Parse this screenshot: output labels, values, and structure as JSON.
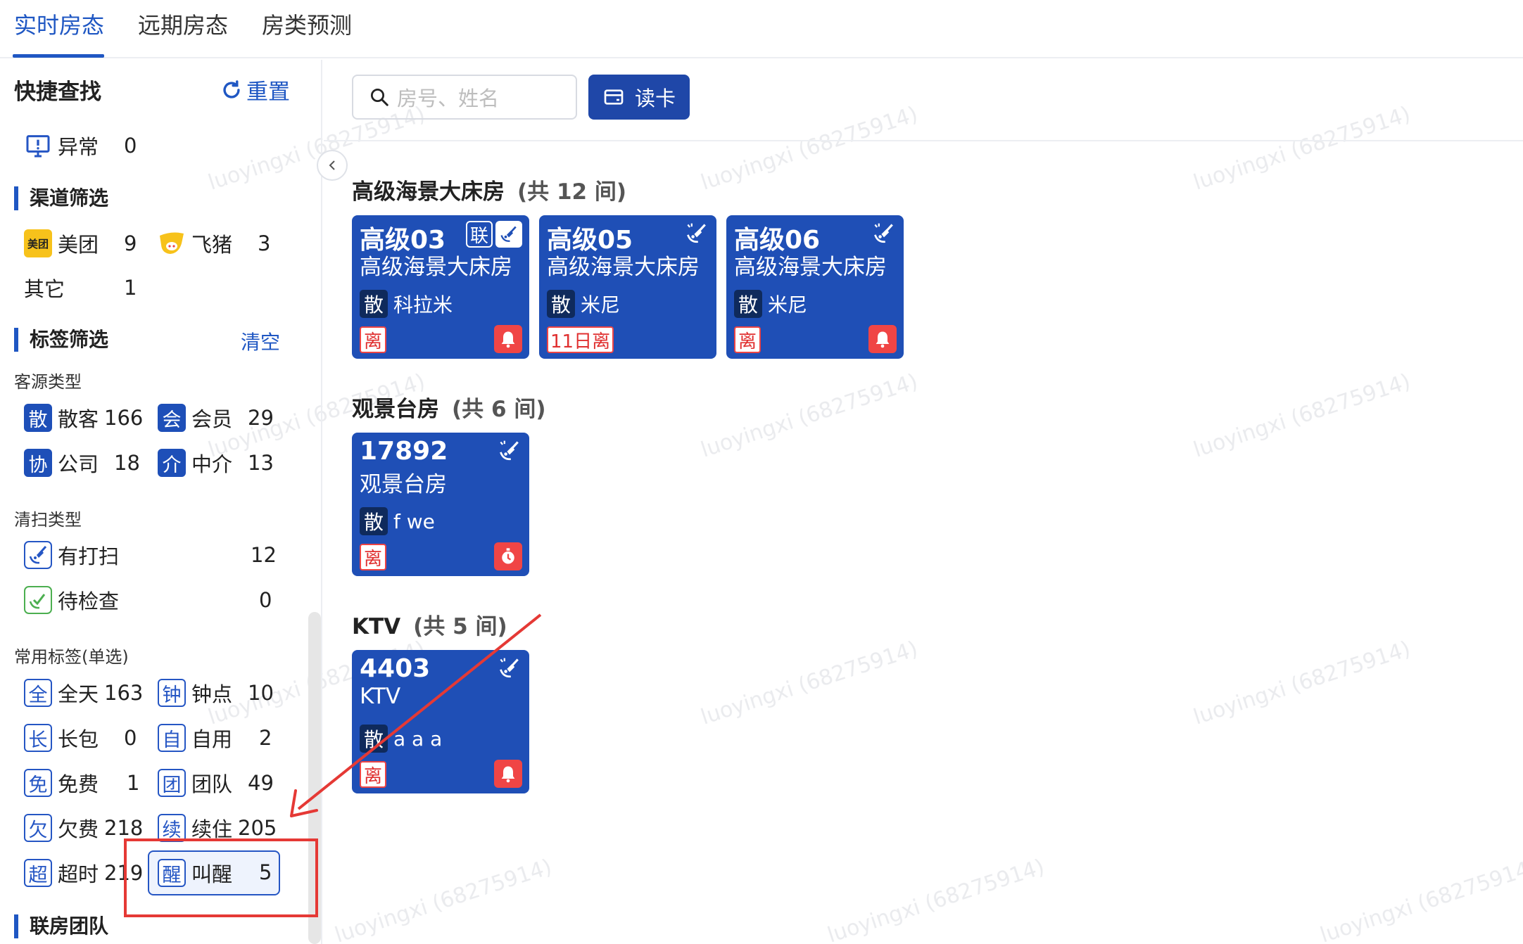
{
  "tabs": [
    {
      "label": "实时房态",
      "active": true
    },
    {
      "label": "远期房态",
      "active": false
    },
    {
      "label": "房类预测",
      "active": false
    }
  ],
  "sidebar": {
    "title": "快捷查找",
    "reset_label": "重置",
    "abnormal": {
      "label": "异常",
      "count": "0"
    },
    "channel_section": "渠道筛选",
    "channels": [
      {
        "label": "美团",
        "count": "9",
        "icon": "meituan-icon",
        "icon_text": "美团"
      },
      {
        "label": "飞猪",
        "count": "3",
        "icon": "fliggy-icon"
      },
      {
        "label": "其它",
        "count": "1"
      }
    ],
    "tag_section": "标签筛选",
    "clear_label": "清空",
    "guest_type_title": "客源类型",
    "guest_types": [
      {
        "badge": "散",
        "label": "散客",
        "count": "166"
      },
      {
        "badge": "会",
        "label": "会员",
        "count": "29"
      },
      {
        "badge": "协",
        "label": "公司",
        "count": "18"
      },
      {
        "badge": "介",
        "label": "中介",
        "count": "13"
      }
    ],
    "clean_type_title": "清扫类型",
    "clean_types": [
      {
        "label": "有打扫",
        "count": "12",
        "icon": "cleaning-icon"
      },
      {
        "label": "待检查",
        "count": "0",
        "icon": "inspection-icon"
      }
    ],
    "common_tags_title": "常用标签(单选)",
    "common_tags": [
      {
        "badge": "全",
        "label": "全天",
        "count": "163"
      },
      {
        "badge": "钟",
        "label": "钟点",
        "count": "10"
      },
      {
        "badge": "长",
        "label": "长包",
        "count": "0"
      },
      {
        "badge": "自",
        "label": "自用",
        "count": "2"
      },
      {
        "badge": "免",
        "label": "免费",
        "count": "1"
      },
      {
        "badge": "团",
        "label": "团队",
        "count": "49"
      },
      {
        "badge": "欠",
        "label": "欠费",
        "count": "218"
      },
      {
        "badge": "续",
        "label": "续住",
        "count": "205"
      },
      {
        "badge": "超",
        "label": "超时",
        "count": "219"
      },
      {
        "badge": "醒",
        "label": "叫醒",
        "count": "5",
        "selected": true
      }
    ],
    "linked_section": "联房团队"
  },
  "search": {
    "placeholder": "房号、姓名"
  },
  "read_card_label": "读卡",
  "groups": [
    {
      "name": "高级海景大床房",
      "count_text": "(共 12 间)",
      "rooms": [
        {
          "number": "高级03",
          "type": "高级海景大床房",
          "guest_badge": "散",
          "guest": "科拉米",
          "leave": "离",
          "linked": "联",
          "status_icon": "bell-icon"
        },
        {
          "number": "高级05",
          "type": "高级海景大床房",
          "guest_badge": "散",
          "guest": "米尼",
          "leave": "11日离",
          "status_icon": ""
        },
        {
          "number": "高级06",
          "type": "高级海景大床房",
          "guest_badge": "散",
          "guest": "米尼",
          "leave": "离",
          "status_icon": "bell-icon"
        }
      ]
    },
    {
      "name": "观景台房",
      "count_text": "(共 6 间)",
      "rooms": [
        {
          "number": "17892",
          "type": "观景台房",
          "guest_badge": "散",
          "guest": "f we",
          "leave": "离",
          "status_icon": "timer-icon"
        }
      ]
    },
    {
      "name": "KTV",
      "count_text": "(共 5 间)",
      "rooms": [
        {
          "number": "4403",
          "type": "KTV",
          "guest_badge": "散",
          "guest": "a a a",
          "leave": "离",
          "status_icon": "bell-icon"
        }
      ]
    }
  ],
  "watermark_text": "luoyingxi (68275914)",
  "colors": {
    "primary": "#1f57c3",
    "room_bg": "#1f4fb6",
    "alert": "#f04545",
    "annotation": "#e53935"
  }
}
